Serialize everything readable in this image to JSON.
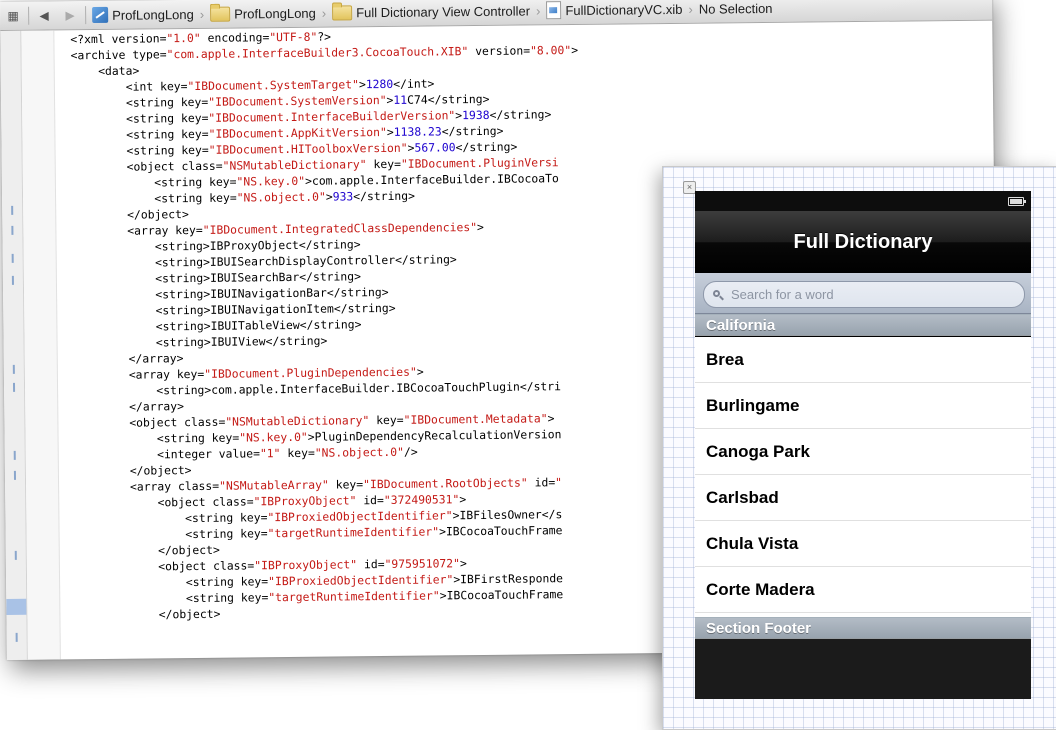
{
  "jumpbar": {
    "items": [
      {
        "label": "ProfLongLong",
        "icon": "project-icon"
      },
      {
        "label": "ProfLongLong",
        "icon": "folder-icon"
      },
      {
        "label": "Full Dictionary View Controller",
        "icon": "folder-icon"
      },
      {
        "label": "FullDictionaryVC.xib",
        "icon": "xib-file-icon"
      },
      {
        "label": "No Selection",
        "icon": ""
      }
    ]
  },
  "code": {
    "lines": [
      [
        [
          "t",
          "<?xml version="
        ],
        [
          "s",
          "\"1.0\""
        ],
        [
          "t",
          " encoding="
        ],
        [
          "s",
          "\"UTF-8\""
        ],
        [
          "t",
          "?>"
        ]
      ],
      [
        [
          "t",
          "<archive type="
        ],
        [
          "s",
          "\"com.apple.InterfaceBuilder3.CocoaTouch.XIB\""
        ],
        [
          "t",
          " version="
        ],
        [
          "s",
          "\"8.00\""
        ],
        [
          "t",
          ">"
        ]
      ],
      [
        [
          "t",
          "    <data>"
        ]
      ],
      [
        [
          "t",
          "        <int key="
        ],
        [
          "s",
          "\"IBDocument.SystemTarget\""
        ],
        [
          "t",
          ">"
        ],
        [
          "n",
          "1280"
        ],
        [
          "t",
          "</int>"
        ]
      ],
      [
        [
          "t",
          "        <string key="
        ],
        [
          "s",
          "\"IBDocument.SystemVersion\""
        ],
        [
          "t",
          ">"
        ],
        [
          "n",
          "11"
        ],
        [
          "t",
          "C74</string>"
        ]
      ],
      [
        [
          "t",
          "        <string key="
        ],
        [
          "s",
          "\"IBDocument.InterfaceBuilderVersion\""
        ],
        [
          "t",
          ">"
        ],
        [
          "n",
          "1938"
        ],
        [
          "t",
          "</string>"
        ]
      ],
      [
        [
          "t",
          "        <string key="
        ],
        [
          "s",
          "\"IBDocument.AppKitVersion\""
        ],
        [
          "t",
          ">"
        ],
        [
          "n",
          "1138.23"
        ],
        [
          "t",
          "</string>"
        ]
      ],
      [
        [
          "t",
          "        <string key="
        ],
        [
          "s",
          "\"IBDocument.HIToolboxVersion\""
        ],
        [
          "t",
          ">"
        ],
        [
          "n",
          "567.00"
        ],
        [
          "t",
          "</string>"
        ]
      ],
      [
        [
          "t",
          "        <object class="
        ],
        [
          "s",
          "\"NSMutableDictionary\""
        ],
        [
          "t",
          " key="
        ],
        [
          "s",
          "\"IBDocument.PluginVersi"
        ]
      ],
      [
        [
          "t",
          "            <string key="
        ],
        [
          "s",
          "\"NS.key.0\""
        ],
        [
          "t",
          ">com.apple.InterfaceBuilder.IBCocoaTo"
        ]
      ],
      [
        [
          "t",
          "            <string key="
        ],
        [
          "s",
          "\"NS.object.0\""
        ],
        [
          "t",
          ">"
        ],
        [
          "n",
          "933"
        ],
        [
          "t",
          "</string>"
        ]
      ],
      [
        [
          "t",
          "        </object>"
        ]
      ],
      [
        [
          "t",
          "        <array key="
        ],
        [
          "s",
          "\"IBDocument.IntegratedClassDependencies\""
        ],
        [
          "t",
          ">"
        ]
      ],
      [
        [
          "t",
          "            <string>IBProxyObject</string>"
        ]
      ],
      [
        [
          "t",
          "            <string>IBUISearchDisplayController</string>"
        ]
      ],
      [
        [
          "t",
          "            <string>IBUISearchBar</string>"
        ]
      ],
      [
        [
          "t",
          "            <string>IBUINavigationBar</string>"
        ]
      ],
      [
        [
          "t",
          "            <string>IBUINavigationItem</string>"
        ]
      ],
      [
        [
          "t",
          "            <string>IBUITableView</string>"
        ]
      ],
      [
        [
          "t",
          "            <string>IBUIView</string>"
        ]
      ],
      [
        [
          "t",
          "        </array>"
        ]
      ],
      [
        [
          "t",
          "        <array key="
        ],
        [
          "s",
          "\"IBDocument.PluginDependencies\""
        ],
        [
          "t",
          ">"
        ]
      ],
      [
        [
          "t",
          "            <string>com.apple.InterfaceBuilder.IBCocoaTouchPlugin</stri"
        ]
      ],
      [
        [
          "t",
          "        </array>"
        ]
      ],
      [
        [
          "t",
          "        <object class="
        ],
        [
          "s",
          "\"NSMutableDictionary\""
        ],
        [
          "t",
          " key="
        ],
        [
          "s",
          "\"IBDocument.Metadata\""
        ],
        [
          "t",
          ">"
        ]
      ],
      [
        [
          "t",
          "            <string key="
        ],
        [
          "s",
          "\"NS.key.0\""
        ],
        [
          "t",
          ">PluginDependencyRecalculationVersion"
        ]
      ],
      [
        [
          "t",
          "            <integer value="
        ],
        [
          "s",
          "\"1\""
        ],
        [
          "t",
          " key="
        ],
        [
          "s",
          "\"NS.object.0\""
        ],
        [
          "t",
          "/>"
        ]
      ],
      [
        [
          "t",
          "        </object>"
        ]
      ],
      [
        [
          "t",
          "        <array class="
        ],
        [
          "s",
          "\"NSMutableArray\""
        ],
        [
          "t",
          " key="
        ],
        [
          "s",
          "\"IBDocument.RootObjects\""
        ],
        [
          "t",
          " id="
        ],
        [
          "s",
          "\""
        ]
      ],
      [
        [
          "t",
          "            <object class="
        ],
        [
          "s",
          "\"IBProxyObject\""
        ],
        [
          "t",
          " id="
        ],
        [
          "s",
          "\"372490531\""
        ],
        [
          "t",
          ">"
        ]
      ],
      [
        [
          "t",
          "                <string key="
        ],
        [
          "s",
          "\"IBProxiedObjectIdentifier\""
        ],
        [
          "t",
          ">IBFilesOwner</s"
        ]
      ],
      [
        [
          "t",
          "                <string key="
        ],
        [
          "s",
          "\"targetRuntimeIdentifier\""
        ],
        [
          "t",
          ">IBCocoaTouchFrame"
        ]
      ],
      [
        [
          "t",
          "            </object>"
        ]
      ],
      [
        [
          "t",
          "            <object class="
        ],
        [
          "s",
          "\"IBProxyObject\""
        ],
        [
          "t",
          " id="
        ],
        [
          "s",
          "\"975951072\""
        ],
        [
          "t",
          ">"
        ]
      ],
      [
        [
          "t",
          "                <string key="
        ],
        [
          "s",
          "\"IBProxiedObjectIdentifier\""
        ],
        [
          "t",
          ">IBFirstResponde"
        ]
      ],
      [
        [
          "t",
          "                <string key="
        ],
        [
          "s",
          "\"targetRuntimeIdentifier\""
        ],
        [
          "t",
          ">IBCocoaTouchFrame"
        ]
      ],
      [
        [
          "t",
          "            </object>"
        ]
      ]
    ]
  },
  "iphone": {
    "nav_title": "Full Dictionary",
    "search_placeholder": "Search for a word",
    "section_header": "California",
    "rows": [
      "Brea",
      "Burlingame",
      "Canoga Park",
      "Carlsbad",
      "Chula Vista",
      "Corte Madera"
    ],
    "section_footer": "Section Footer"
  },
  "colors": {
    "xml_string": "#c41a16",
    "xml_number": "#1c00cf",
    "section_header": "#a4afba"
  }
}
